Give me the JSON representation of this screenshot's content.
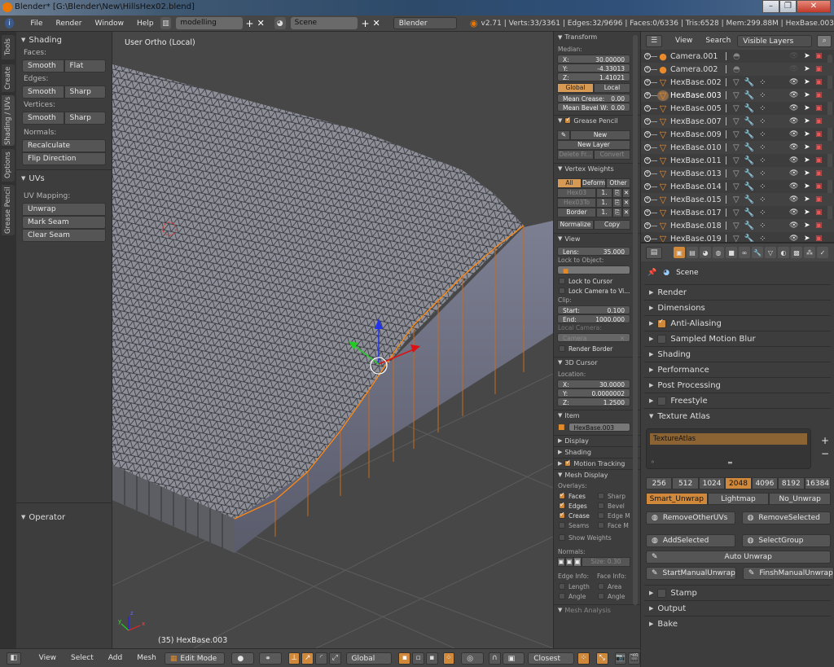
{
  "window": {
    "title": "Blender* [G:\\Blender\\New\\HillsHex02.blend]",
    "buttons": {
      "minimize": "–",
      "maximize": "❐",
      "close": "✕"
    }
  },
  "top_header": {
    "menus": [
      "File",
      "Render",
      "Window",
      "Help"
    ],
    "screen_layout": "modelling",
    "scene": "Scene",
    "render_engine": "Blender Render",
    "stats": "v2.71 | Verts:33/3361 | Edges:32/9696 | Faces:0/6336 | Tris:6528 | Mem:299.88M | HexBase.003"
  },
  "tool_tabs": [
    "Tools",
    "Create",
    "Shading / UVs",
    "Options",
    "Grease Pencil"
  ],
  "tool_shelf": {
    "shading": {
      "title": "Shading",
      "faces_label": "Faces:",
      "faces_buttons": [
        "Smooth",
        "Flat"
      ],
      "edges_label": "Edges:",
      "edges_buttons": [
        "Smooth",
        "Sharp"
      ],
      "vertices_label": "Vertices:",
      "vertices_buttons": [
        "Smooth",
        "Sharp"
      ],
      "normals_label": "Normals:",
      "normals_buttons": [
        "Recalculate",
        "Flip Direction"
      ]
    },
    "uvs": {
      "title": "UVs",
      "uv_mapping_label": "UV Mapping:",
      "unwrap": "Unwrap",
      "mark_seam": "Mark Seam",
      "clear_seam": "Clear Seam"
    },
    "operator": {
      "title": "Operator"
    }
  },
  "viewport": {
    "view_label": "User Ortho (Local)",
    "object_label": "(35) HexBase.003",
    "axis_labels": {
      "x": "x",
      "y": "y",
      "z": "z"
    }
  },
  "n_panel": {
    "transform": {
      "title": "Transform",
      "median_label": "Median:",
      "x": {
        "label": "X:",
        "value": "30.00000"
      },
      "y": {
        "label": "Y:",
        "value": "-4.33013"
      },
      "z": {
        "label": "Z:",
        "value": "1.41021"
      },
      "global": "Global",
      "local": "Local",
      "mean_crease": {
        "label": "Mean Crease:",
        "value": "0.00"
      },
      "mean_bevel": {
        "label": "Mean Bevel W:",
        "value": "0.00"
      }
    },
    "grease_pencil": {
      "title": "Grease Pencil",
      "enabled": true,
      "new": "New",
      "new_layer": "New Layer",
      "delete_frame": "Delete Fr...",
      "convert": "Convert"
    },
    "vertex_weights": {
      "title": "Vertex Weights",
      "tabs": [
        "All",
        "Deform",
        "Other"
      ],
      "groups": [
        {
          "name": "Hex03",
          "value": "1."
        },
        {
          "name": "Hex03To",
          "value": "1."
        },
        {
          "name": "Border",
          "value": "1."
        }
      ],
      "normalize": "Normalize",
      "copy": "Copy"
    },
    "view": {
      "title": "View",
      "lens": {
        "label": "Lens:",
        "value": "35.000"
      },
      "lock_to_object": "Lock to Object:",
      "lock_to_cursor": "Lock to Cursor",
      "lock_camera": "Lock Camera to Vi...",
      "clip_label": "Clip:",
      "clip_start": {
        "label": "Start:",
        "value": "0.100"
      },
      "clip_end": {
        "label": "End:",
        "value": "1000.000"
      },
      "local_camera_label": "Local Camera:",
      "local_camera": "Camera",
      "render_border": "Render Border"
    },
    "cursor": {
      "title": "3D Cursor",
      "location_label": "Location:",
      "x": {
        "label": "X:",
        "value": "30.0000"
      },
      "y": {
        "label": "Y:",
        "value": "0.0000002"
      },
      "z": {
        "label": "Z:",
        "value": "1.2500"
      }
    },
    "item": {
      "title": "Item",
      "name": "HexBase.003"
    },
    "collapsed": [
      "Display",
      "Shading"
    ],
    "motion_tracking": "Motion Tracking",
    "mesh_display": {
      "title": "Mesh Display",
      "overlays_label": "Overlays:",
      "overlays": [
        {
          "label": "Faces",
          "on": true
        },
        {
          "label": "Sharp",
          "on": false
        },
        {
          "label": "Edges",
          "on": true
        },
        {
          "label": "Bevel",
          "on": false
        },
        {
          "label": "Crease",
          "on": true
        },
        {
          "label": "Edge M",
          "on": false
        },
        {
          "label": "Seams",
          "on": false
        },
        {
          "label": "Face M",
          "on": false
        }
      ],
      "show_weights": "Show Weights",
      "normals_label": "Normals:",
      "normal_size": "Size: 0.30",
      "edge_info": "Edge Info:",
      "face_info": "Face Info:",
      "length": "Length",
      "area": "Area",
      "angle1": "Angle",
      "angle2": "Angle",
      "mesh_analysis": "Mesh Analysis"
    }
  },
  "bottom_header": {
    "menus": [
      "View",
      "Select",
      "Add",
      "Mesh"
    ],
    "mode": "Edit Mode",
    "orientation": "Global",
    "snap_target": "Closest"
  },
  "outliner": {
    "view": "View",
    "search": "Search",
    "filter": "Visible Layers",
    "items": [
      {
        "name": "Camera.001",
        "type": "camera",
        "visible": false
      },
      {
        "name": "Camera.002",
        "type": "camera",
        "visible": false
      },
      {
        "name": "HexBase.002",
        "type": "mesh",
        "visible": true
      },
      {
        "name": "HexBase.003",
        "type": "mesh",
        "visible": true,
        "active": true
      },
      {
        "name": "HexBase.005",
        "type": "mesh",
        "visible": true
      },
      {
        "name": "HexBase.007",
        "type": "mesh",
        "visible": true
      },
      {
        "name": "HexBase.009",
        "type": "mesh",
        "visible": true
      },
      {
        "name": "HexBase.010",
        "type": "mesh",
        "visible": true
      },
      {
        "name": "HexBase.011",
        "type": "mesh",
        "visible": true
      },
      {
        "name": "HexBase.013",
        "type": "mesh",
        "visible": true
      },
      {
        "name": "HexBase.014",
        "type": "mesh",
        "visible": true
      },
      {
        "name": "HexBase.015",
        "type": "mesh",
        "visible": true
      },
      {
        "name": "HexBase.017",
        "type": "mesh",
        "visible": true
      },
      {
        "name": "HexBase.018",
        "type": "mesh",
        "visible": true
      },
      {
        "name": "HexBase.019",
        "type": "mesh",
        "visible": true
      }
    ]
  },
  "properties": {
    "context": "Scene",
    "sections": [
      {
        "label": "Render",
        "checkbox": null
      },
      {
        "label": "Dimensions",
        "checkbox": null
      },
      {
        "label": "Anti-Aliasing",
        "checkbox": true
      },
      {
        "label": "Sampled Motion Blur",
        "checkbox": false
      },
      {
        "label": "Shading",
        "checkbox": null
      },
      {
        "label": "Performance",
        "checkbox": null
      },
      {
        "label": "Post Processing",
        "checkbox": null
      },
      {
        "label": "Freestyle",
        "checkbox": false
      }
    ],
    "texture_atlas": {
      "title": "Texture Atlas",
      "list_item": "TextureAtlas",
      "sizes": [
        "256",
        "512",
        "1024",
        "2048",
        "4096",
        "8192",
        "16384"
      ],
      "selected_size": "2048",
      "unwrap_modes": [
        "Smart_Unwrap",
        "Lightmap",
        "No_Unwrap"
      ],
      "selected_mode": "Smart_Unwrap",
      "remove_other_uvs": "RemoveOtherUVs",
      "remove_selected": "RemoveSelected",
      "add_selected": "AddSelected",
      "select_group": "SelectGroup",
      "auto_unwrap": "Auto Unwrap",
      "start_manual": "StartManualUnwrap",
      "finish_manual": "FinshManualUnwrap"
    },
    "after_sections": [
      {
        "label": "Stamp",
        "checkbox": false
      },
      {
        "label": "Output",
        "checkbox": null
      },
      {
        "label": "Bake",
        "checkbox": null
      }
    ]
  },
  "colors": {
    "accent": "#d0883a",
    "panel": "#3d3d3d",
    "header": "#464646",
    "viewport": "#474747",
    "mesh": "#9a9aa4",
    "selected_vertex": "#ff8a14"
  }
}
